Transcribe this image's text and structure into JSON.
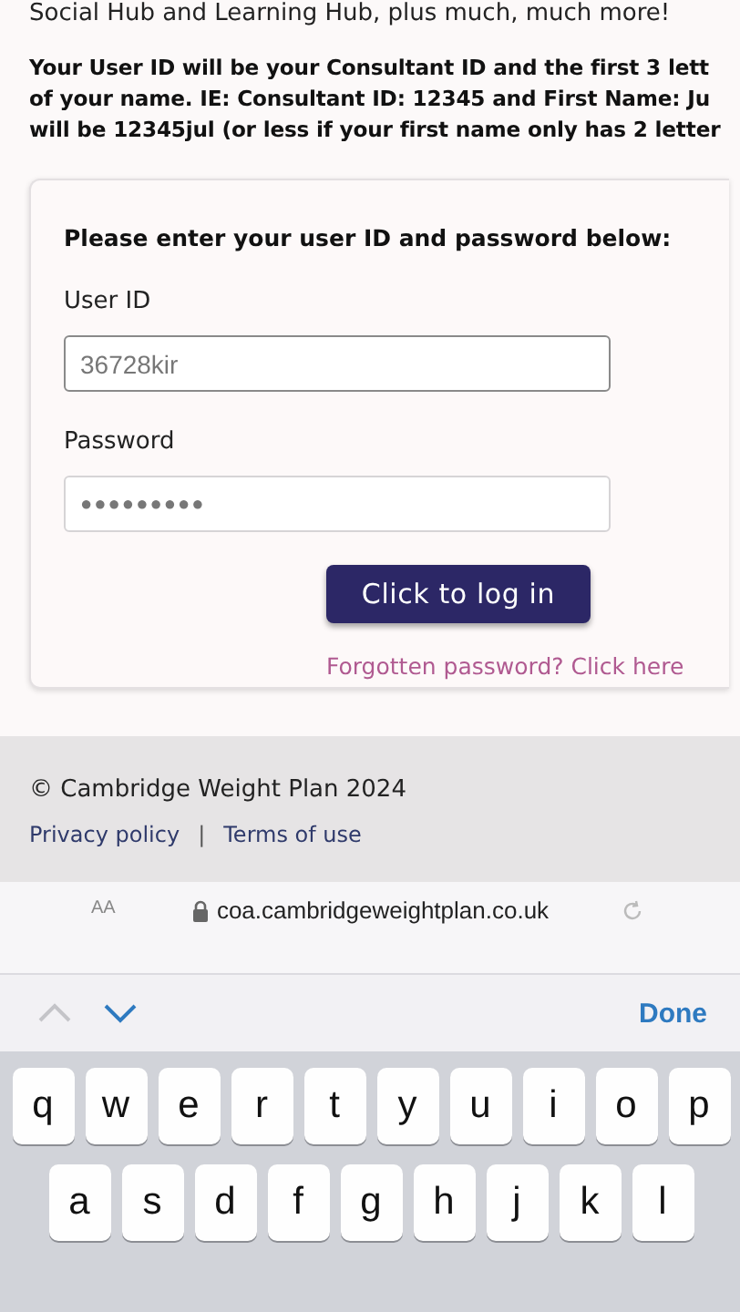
{
  "page": {
    "intro": "Social Hub and Learning Hub, plus much, much more!",
    "notice_lines": [
      "Your User ID will be your Consultant ID and the first 3 lett",
      "of your name. IE: Consultant ID: 12345 and First Name: Ju",
      "will be 12345jul (or less if your first name only has 2 letter"
    ]
  },
  "login": {
    "heading": "Please enter your user ID and password below:",
    "fields": [
      {
        "label": "User ID",
        "value": "36728kir",
        "kind": "text"
      },
      {
        "label": "Password",
        "value": "●●●●●●●●●",
        "kind": "password"
      }
    ],
    "button": "Click to log in",
    "forgot_link": "Forgotten password? Click here"
  },
  "footer": {
    "copyright": "© Cambridge Weight Plan 2024",
    "links": [
      "Privacy policy",
      "Terms of use"
    ],
    "separator": "|"
  },
  "browser": {
    "text_size": "AA",
    "url": "coa.cambridgeweightplan.co.uk"
  },
  "keyboard_toolbar": {
    "arrows": [
      {
        "kind": "up",
        "disabled": true
      },
      {
        "kind": "down",
        "disabled": false
      }
    ],
    "done": "Done"
  },
  "keyboard": {
    "rows": [
      [
        "q",
        "w",
        "e",
        "r",
        "t",
        "y",
        "u",
        "i",
        "o",
        "p"
      ],
      [
        "a",
        "s",
        "d",
        "f",
        "g",
        "h",
        "j",
        "k",
        "l"
      ]
    ]
  }
}
